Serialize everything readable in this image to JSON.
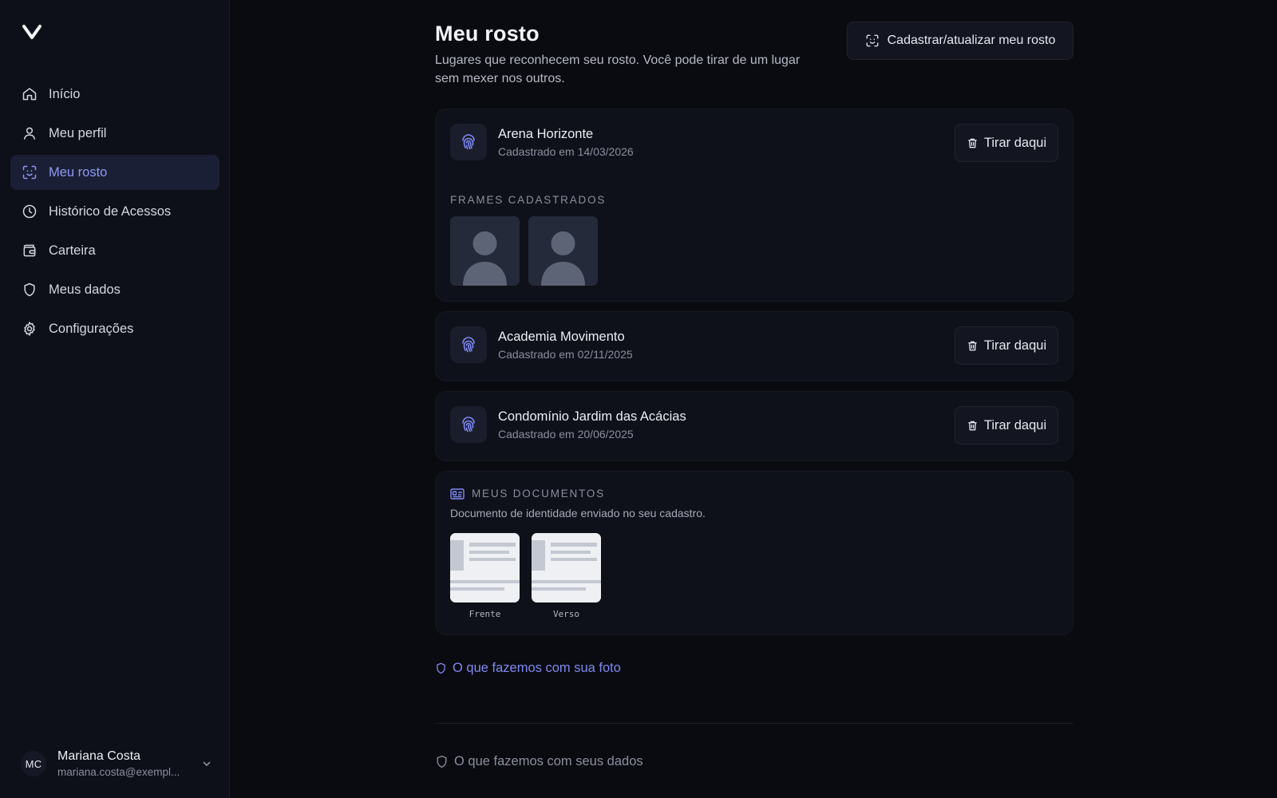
{
  "sidebar": {
    "logo_icon": "v-logo-icon",
    "items": [
      {
        "label": "Início",
        "icon": "home-icon"
      },
      {
        "label": "Meu perfil",
        "icon": "user-icon"
      },
      {
        "label": "Meu rosto",
        "icon": "face-scan-icon",
        "active": true
      },
      {
        "label": "Histórico de Acessos",
        "icon": "clock-icon"
      },
      {
        "label": "Carteira",
        "icon": "wallet-icon"
      },
      {
        "label": "Meus dados",
        "icon": "shield-icon"
      },
      {
        "label": "Configurações",
        "icon": "gear-icon"
      }
    ],
    "user": {
      "initials": "MC",
      "name": "Mariana Costa",
      "email": "mariana.costa@exempl..."
    }
  },
  "main": {
    "title": "Meu rosto",
    "subtitle": "Lugares que reconhecem seu rosto. Você pode tirar de um lugar sem mexer nos outros.",
    "register_button": "Cadastrar/atualizar meu rosto",
    "places": [
      {
        "name": "Arena Horizonte",
        "date": "Cadastrado em 14/03/2026",
        "remove_label": "Tirar daqui",
        "frames_label": "FRAMES CADASTRADOS",
        "frames": 2
      },
      {
        "name": "Academia Movimento",
        "date": "Cadastrado em 02/11/2025",
        "remove_label": "Tirar daqui"
      },
      {
        "name": "Condomínio Jardim das Acácias",
        "date": "Cadastrado em 20/06/2025",
        "remove_label": "Tirar daqui"
      }
    ],
    "documents": {
      "title": "MEUS DOCUMENTOS",
      "description": "Documento de identidade enviado no seu cadastro.",
      "items": [
        {
          "caption": "Frente"
        },
        {
          "caption": "Verso"
        }
      ]
    },
    "photo_link": "O que fazemos com sua foto",
    "data_link": "O que fazemos com seus dados"
  },
  "colors": {
    "background": "#0a0b10",
    "sidebar": "#0e1019",
    "accent": "#7f89f2",
    "active_bg": "#1b1f35"
  }
}
